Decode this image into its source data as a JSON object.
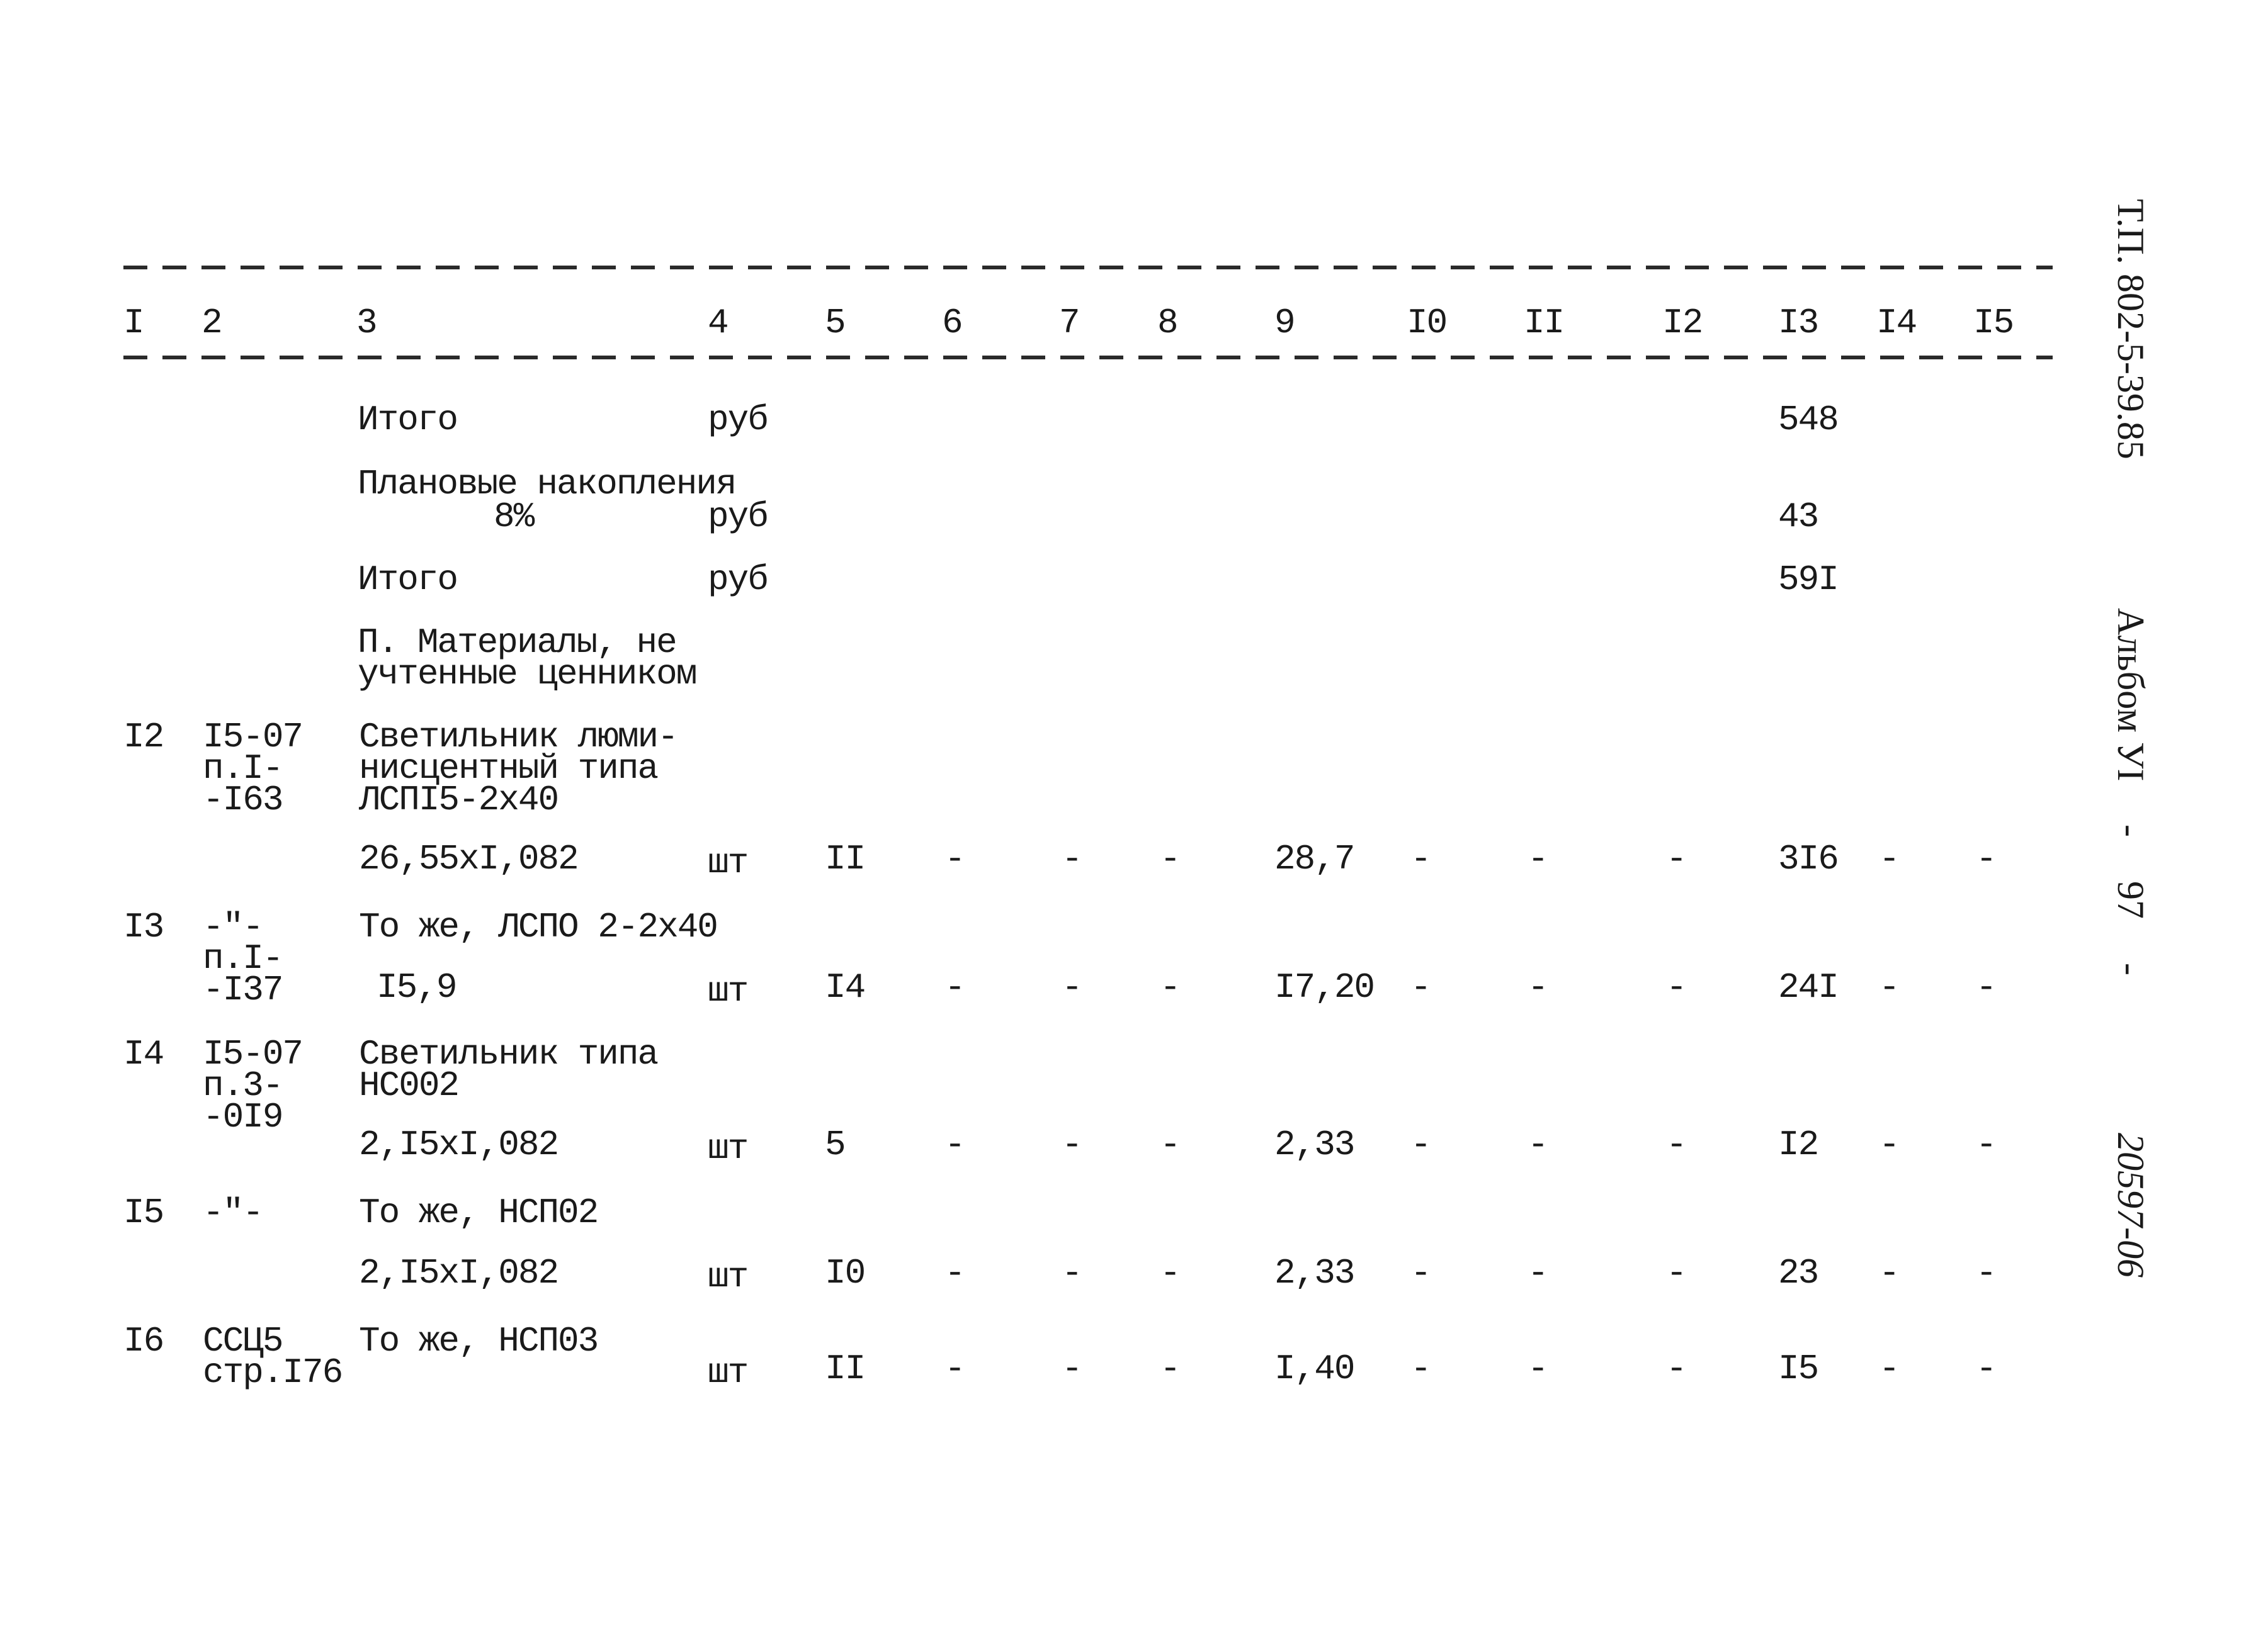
{
  "side_labels": {
    "doc_code": "Т.П. 802-5-39.85",
    "album": "Альбом УI",
    "sep1": "-",
    "page": "97",
    "sep2": "-",
    "inventory": "20597-06"
  },
  "header": [
    "I",
    "2",
    "3",
    "4",
    "5",
    "6",
    "7",
    "8",
    "9",
    "I0",
    "II",
    "I2",
    "I3",
    "I4",
    "I5"
  ],
  "summary": [
    {
      "name": "Итого",
      "unit": "руб",
      "c13": "548"
    },
    {
      "name_line1": "Плановые накопления",
      "name_line2": "8%",
      "unit": "руб",
      "c13": "43"
    },
    {
      "name": "Итого",
      "unit": "руб",
      "c13": "59I"
    }
  ],
  "section_title": {
    "line1": "П. Материалы, не",
    "line2": "учтенные ценником"
  },
  "items": [
    {
      "no": "I2",
      "ref": [
        "I5-07",
        "п.I-",
        "-I63"
      ],
      "desc": [
        "Светильник люми-",
        "нисцентный типа",
        "ЛСПI5-2х40"
      ],
      "calc": "26,55хI,082",
      "unit": "шт",
      "c5": "II",
      "c6": "-",
      "c7": "-",
      "c8": "-",
      "c9": "28,7",
      "c10": "-",
      "c11": "-",
      "c12": "-",
      "c13": "3I6",
      "c14": "-",
      "c15": "-"
    },
    {
      "no": "I3",
      "ref": [
        "-\"-",
        "п.I-",
        "-I37"
      ],
      "desc": [
        "То же, ЛСПО 2-2х40"
      ],
      "calc": "I5,9",
      "unit": "шт",
      "c5": "I4",
      "c6": "-",
      "c7": "-",
      "c8": "-",
      "c9": "I7,20",
      "c10": "-",
      "c11": "-",
      "c12": "-",
      "c13": "24I",
      "c14": "-",
      "c15": "-"
    },
    {
      "no": "I4",
      "ref": [
        "I5-07",
        "п.3-",
        "-0I9"
      ],
      "desc": [
        "Светильник типа",
        "НС002"
      ],
      "calc": "2,I5хI,082",
      "unit": "шт",
      "c5": "5",
      "c6": "-",
      "c7": "-",
      "c8": "-",
      "c9": "2,33",
      "c10": "-",
      "c11": "-",
      "c12": "-",
      "c13": "I2",
      "c14": "-",
      "c15": "-"
    },
    {
      "no": "I5",
      "ref": [
        "-\"-"
      ],
      "desc": [
        "То же, НСП02"
      ],
      "calc": "2,I5хI,082",
      "unit": "шт",
      "c5": "I0",
      "c6": "-",
      "c7": "-",
      "c8": "-",
      "c9": "2,33",
      "c10": "-",
      "c11": "-",
      "c12": "-",
      "c13": "23",
      "c14": "-",
      "c15": "-"
    },
    {
      "no": "I6",
      "ref": [
        "ССЦ5",
        "стр.I76"
      ],
      "desc": [
        "То же, НСП03"
      ],
      "calc": "",
      "unit": "шт",
      "c5": "II",
      "c6": "-",
      "c7": "-",
      "c8": "-",
      "c9": "I,40",
      "c10": "-",
      "c11": "-",
      "c12": "-",
      "c13": "I5",
      "c14": "-",
      "c15": "-"
    }
  ]
}
